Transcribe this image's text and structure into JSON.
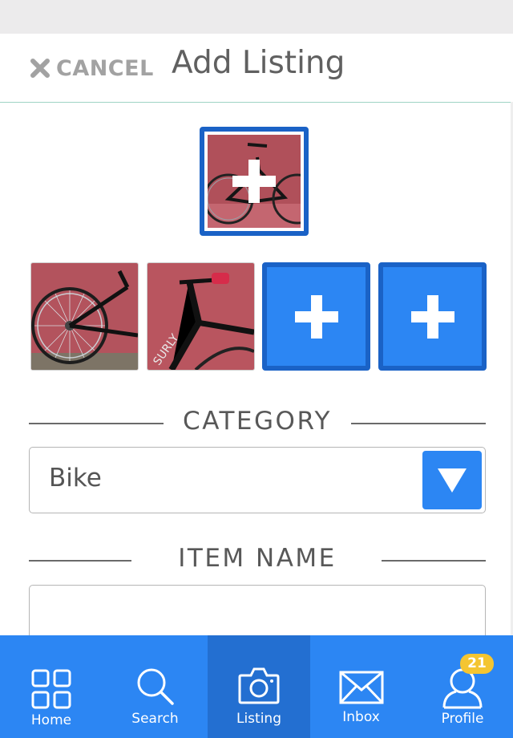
{
  "header": {
    "cancel_label": "CANCEL",
    "title": "Add Listing"
  },
  "photos": {
    "main_photo": "bike-rear-wheel-red-wall",
    "slots": [
      "bike-rear-wheel-red-wall",
      "bike-handlebar-surly-red-wall",
      "add-photo",
      "add-photo"
    ]
  },
  "category": {
    "label": "CATEGORY",
    "selected": "Bike"
  },
  "item_name": {
    "label": "ITEM NAME",
    "value": ""
  },
  "tabbar": {
    "tabs": [
      {
        "label": "Home",
        "icon": "grid-icon",
        "active": false
      },
      {
        "label": "Search",
        "icon": "search-icon",
        "active": false
      },
      {
        "label": "Listing",
        "icon": "camera-icon",
        "active": true
      },
      {
        "label": "Inbox",
        "icon": "envelope-icon",
        "active": false
      },
      {
        "label": "Profile",
        "icon": "user-icon",
        "active": false
      }
    ],
    "profile_badge": "21"
  },
  "colors": {
    "accent": "#2c86f3",
    "accent_dark": "#1a62c6",
    "badge": "#f4c531",
    "text": "#585858"
  }
}
